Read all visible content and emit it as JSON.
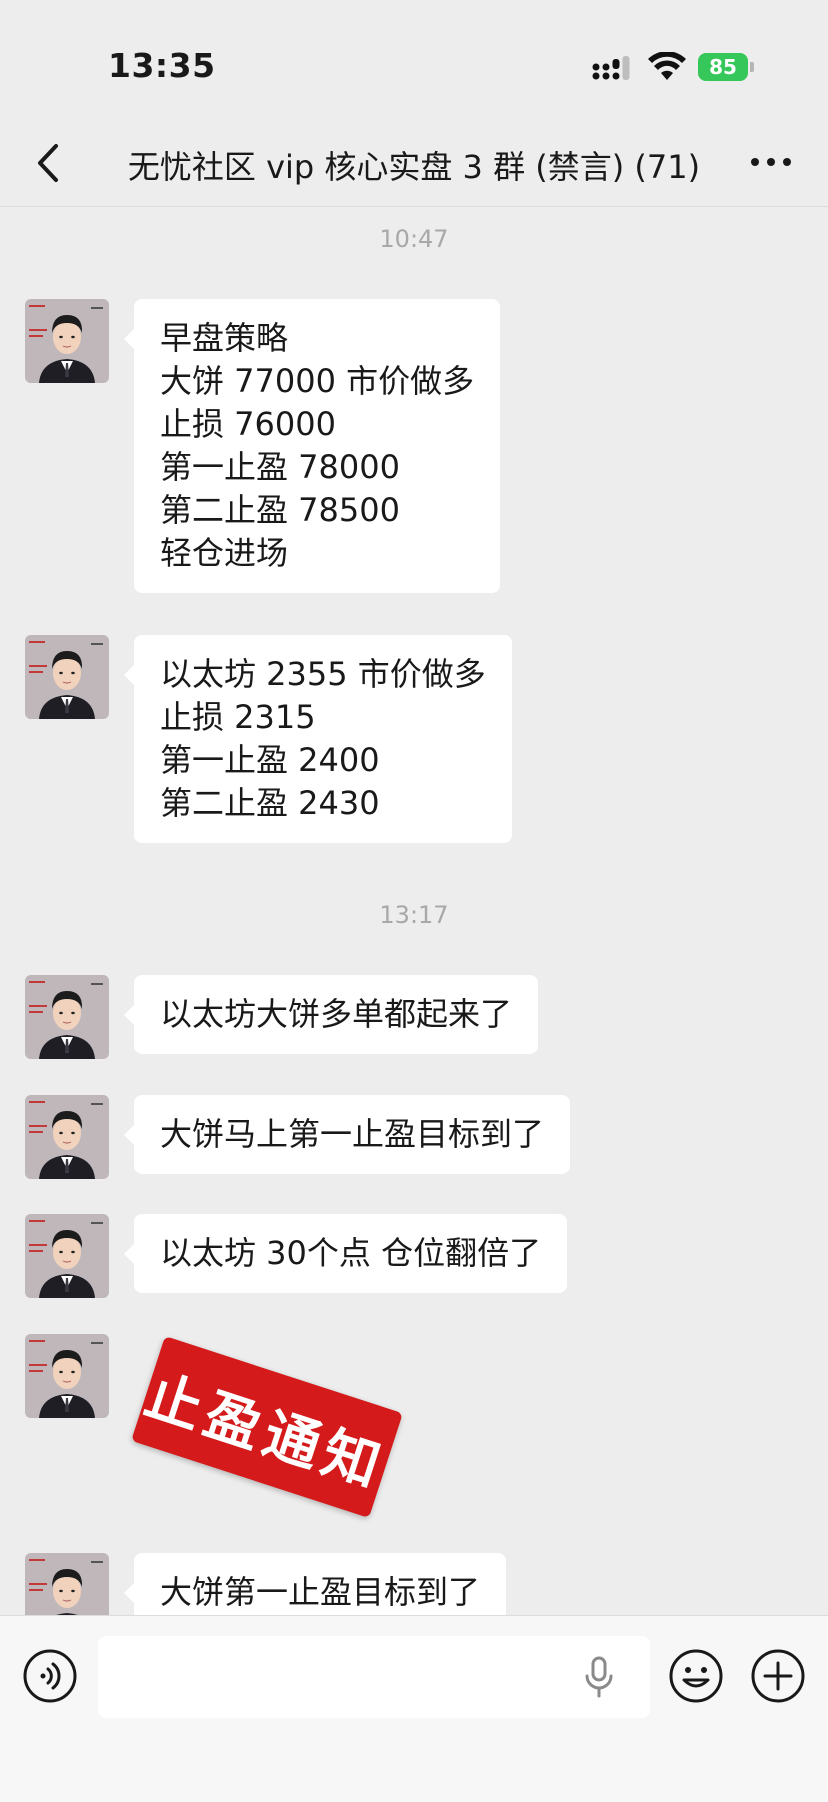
{
  "status_bar": {
    "time": "13:35",
    "battery": "85"
  },
  "header": {
    "title": "无忧社区 vip 核心实盘 3 群 (禁言) (71)"
  },
  "timestamps": [
    "10:47",
    "13:17"
  ],
  "messages": [
    {
      "text": "早盘策略\n大饼 77000 市价做多\n止损 76000\n第一止盈 78000\n第二止盈 78500\n轻仓进场"
    },
    {
      "text": "以太坊 2355 市价做多\n止损 2315\n第一止盈 2400\n第二止盈 2430"
    },
    {
      "text": "以太坊大饼多单都起来了"
    },
    {
      "text": "大饼马上第一止盈目标到了"
    },
    {
      "text": "以太坊 30个点 仓位翻倍了"
    },
    {
      "text": "大饼第一止盈目标到了"
    }
  ],
  "sticker": {
    "text": "止盈通知",
    "color": "#d41a1a"
  },
  "input": {
    "placeholder": ""
  },
  "colors": {
    "background": "#ededed",
    "bubble": "#ffffff",
    "battery": "#35c759"
  }
}
